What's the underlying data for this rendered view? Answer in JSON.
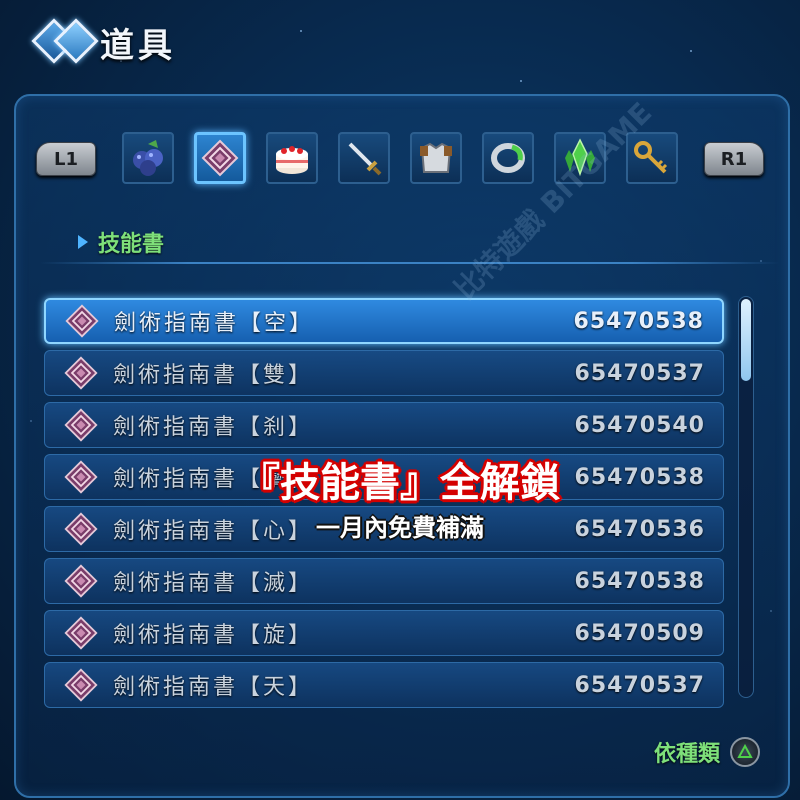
{
  "header": {
    "title": "道具",
    "icon": "menu-diamond-icon"
  },
  "category_bar": {
    "left_button": "L1",
    "right_button": "R1",
    "categories": [
      {
        "icon": "blueberry-icon",
        "selected": false
      },
      {
        "icon": "skill-book-icon",
        "selected": true
      },
      {
        "icon": "cake-icon",
        "selected": false
      },
      {
        "icon": "sword-icon",
        "selected": false
      },
      {
        "icon": "armor-icon",
        "selected": false
      },
      {
        "icon": "ring-icon",
        "selected": false
      },
      {
        "icon": "crystal-icon",
        "selected": false
      },
      {
        "icon": "key-icon",
        "selected": false
      }
    ],
    "active_label": "技能書"
  },
  "items": [
    {
      "name": "劍術指南書【空】",
      "qty": "65470538",
      "selected": true
    },
    {
      "name": "劍術指南書【雙】",
      "qty": "65470537",
      "selected": false
    },
    {
      "name": "劍術指南書【刹】",
      "qty": "65470540",
      "selected": false
    },
    {
      "name": "劍術指南書【攣】",
      "qty": "65470538",
      "selected": false
    },
    {
      "name": "劍術指南書【心】",
      "qty": "65470536",
      "selected": false
    },
    {
      "name": "劍術指南書【滅】",
      "qty": "65470538",
      "selected": false
    },
    {
      "name": "劍術指南書【旋】",
      "qty": "65470509",
      "selected": false
    },
    {
      "name": "劍術指南書【天】",
      "qty": "65470537",
      "selected": false
    }
  ],
  "promo": {
    "line1": "『技能書』全解鎖",
    "line2": "一月內免費補滿"
  },
  "footer": {
    "sort_label": "依種類",
    "sort_button": "triangle-button-icon"
  },
  "watermark": "比特遊戲 BITGAME",
  "colors": {
    "accent": "#6cc4ff",
    "label_green": "#7ee07a",
    "promo_red": "#d40000"
  }
}
